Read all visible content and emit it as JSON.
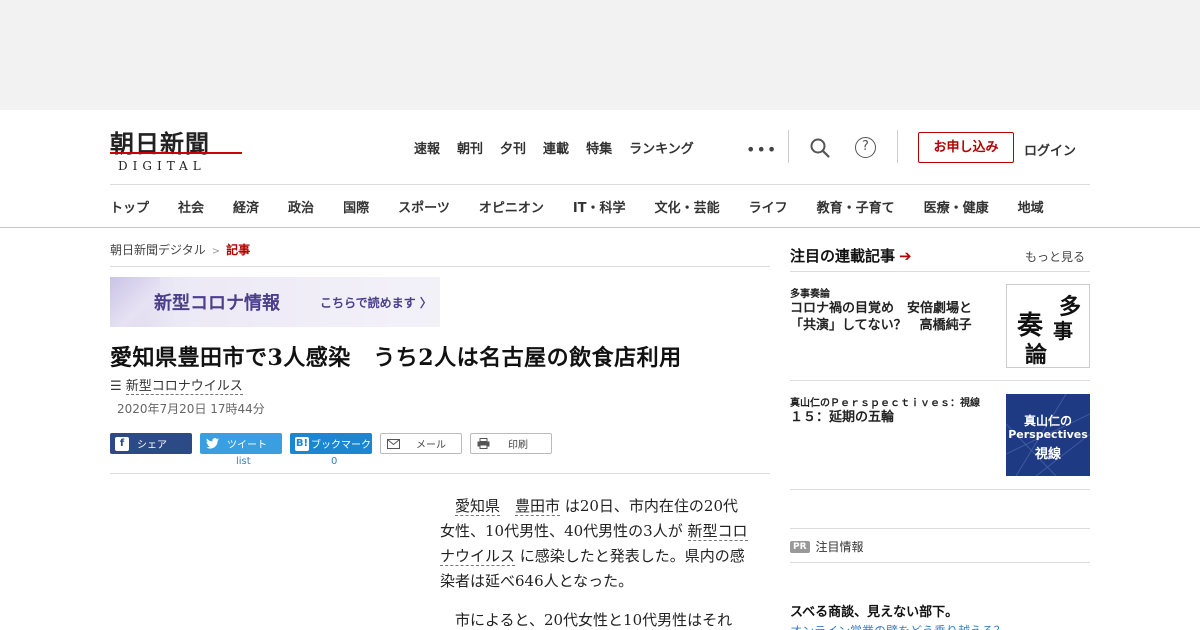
{
  "header": {
    "logo_kanji": "朝日新聞",
    "logo_sub": "DIGITAL",
    "top_nav": [
      "速報",
      "朝刊",
      "夕刊",
      "連載",
      "特集",
      "ランキング"
    ],
    "more_label": "•••",
    "help_label": "?",
    "signup_label": "お申し込み",
    "login_label": "ログイン",
    "section_nav": [
      "トップ",
      "社会",
      "経済",
      "政治",
      "国際",
      "スポーツ",
      "オピニオン",
      "IT・科学",
      "文化・芸能",
      "ライフ",
      "教育・子育て",
      "医療・健康",
      "地域"
    ]
  },
  "breadcrumb": {
    "home": "朝日新聞デジタル",
    "separator": ">",
    "current": "記事"
  },
  "covid_banner": {
    "title": "新型コロナ情報",
    "link": "こちらで読めます 〉"
  },
  "article": {
    "headline": "愛知県豊田市で3人感染　うち2人は名古屋の飲食店利用",
    "topic_icon": "☰",
    "topic": "新型コロナウイルス",
    "date": "2020年7月20日 17時44分",
    "share": {
      "facebook": "シェア",
      "twitter": "ツイート",
      "hatena": "ブックマーク",
      "mail": "メール",
      "print": "印刷",
      "twitter_count": "list",
      "hatena_count": "0"
    },
    "p1_kw1": "愛知県",
    "p1_kw2": "豊田市",
    "p1_a": "は20日、市内在住の20代女性、10代男性、40代男性の3人が",
    "p1_kw3": "新型コロナウイルス",
    "p1_b": "に感染したと発表した。県内の感染者は延べ646人となった。",
    "p2": "市によると、20代女性と10代男性はそれ"
  },
  "sidebar": {
    "heading": "注目の連載記事",
    "more": "もっと見る",
    "items": [
      {
        "category": "多事奏論",
        "title": "コロナ禍の目覚め　安倍劇場と「共演」してない？　高橋純子",
        "thumb_chars": [
          "多",
          "事",
          "奏",
          "論"
        ]
      },
      {
        "category": "真山仁のＰｅｒｓｐｅｃｔｉｖｅｓ：視線",
        "title": "１５：延期の五輪",
        "thumb_lines": [
          "真山仁の",
          "Perspectives",
          "視線"
        ]
      }
    ],
    "pr_badge": "PR",
    "pr_label": "注目情報",
    "pr_title": "スベる商談、見えない部下。",
    "pr_sub": "オンライン営業の壁をどう乗り越える？"
  },
  "colors": {
    "accent": "#b30000",
    "facebook": "#2c4a86",
    "twitter": "#3a9fe0",
    "hatena": "#1c86d1",
    "banner_text": "#4b3f8c",
    "thumb_navy": "#1d3a82"
  }
}
